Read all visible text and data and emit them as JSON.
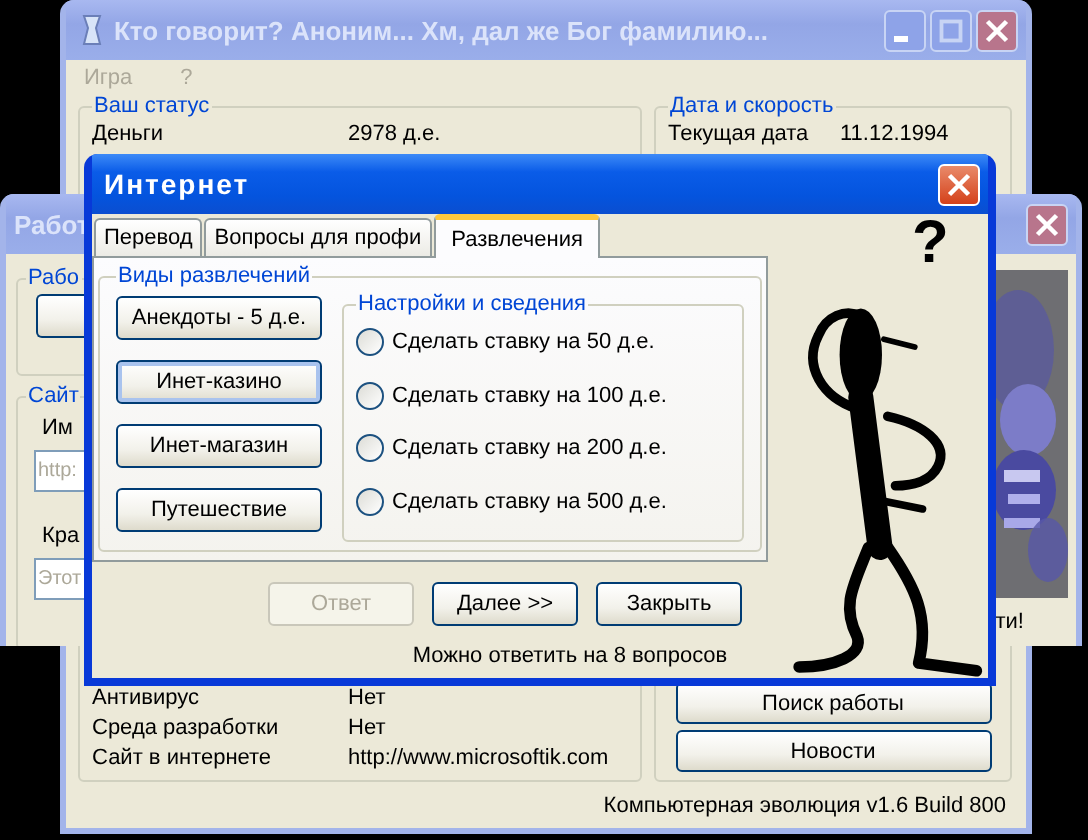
{
  "main_window": {
    "title": "Кто говорит? Аноним... Хм, дал же Бог фамилию...",
    "active": false,
    "menu": [
      "Игра",
      "?"
    ],
    "status_group": {
      "title": "Ваш статус",
      "rows": [
        {
          "label": "Деньги",
          "value": "2978 д.е."
        },
        {
          "label": "Антивирус",
          "value": "Нет"
        },
        {
          "label": "Среда разработки",
          "value": "Нет"
        },
        {
          "label": "Сайт в интернете",
          "value": "http://www.microsoftik.com"
        }
      ]
    },
    "date_group": {
      "title": "Дата и скорость",
      "rows": [
        {
          "label": "Текущая дата",
          "value": "11.12.1994"
        }
      ],
      "buttons": [
        "Поиск работы",
        "Новости"
      ]
    },
    "status_bar": "Компьютерная эволюция v1.6 Build 800"
  },
  "work_window": {
    "title": "Работ",
    "active": false,
    "group_1": {
      "title": "Рабо"
    },
    "group_2": {
      "title": "Сайт",
      "fields": [
        {
          "label": "Им",
          "placeholder": "http:"
        },
        {
          "label": "Кра",
          "placeholder": "Этот"
        }
      ]
    },
    "caption": "ти!"
  },
  "internet_window": {
    "title": "Интернет",
    "active": true,
    "tabs": [
      {
        "label": "Перевод",
        "selected": false
      },
      {
        "label": "Вопросы для профи",
        "selected": false
      },
      {
        "label": "Развлечения",
        "selected": true
      }
    ],
    "group_1": {
      "title": "Виды развлечений",
      "buttons": [
        {
          "label": "Анекдоты - 5 д.е.",
          "focused": false
        },
        {
          "label": "Инет-казино",
          "focused": true
        },
        {
          "label": "Инет-магазин",
          "focused": false
        },
        {
          "label": "Путешествие",
          "focused": false
        }
      ]
    },
    "group_2": {
      "title": "Настройки и сведения",
      "options": [
        {
          "label": "Сделать ставку на 50 д.е.",
          "selected": false
        },
        {
          "label": "Сделать ставку на 100 д.е.",
          "selected": false
        },
        {
          "label": "Сделать ставку на 200 д.е.",
          "selected": false
        },
        {
          "label": "Сделать ставку на 500 д.е.",
          "selected": false
        }
      ]
    },
    "buttons": [
      {
        "label": "Ответ",
        "disabled": true
      },
      {
        "label": "Далее >>",
        "disabled": false
      },
      {
        "label": "Закрыть",
        "disabled": false
      }
    ],
    "note": "Можно ответить на 8 вопросов",
    "figure_mark": "?"
  }
}
